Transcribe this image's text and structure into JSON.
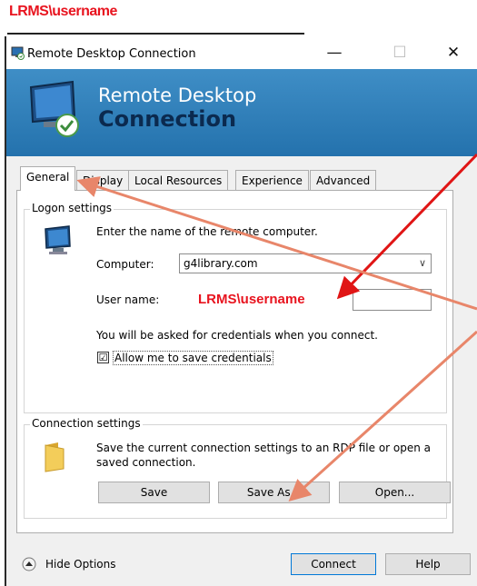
{
  "annotation": {
    "top_label": "LRMS\\username",
    "overlay_username": "LRMS\\username"
  },
  "window": {
    "title": "Remote Desktop Connection",
    "minimize_glyph": "—",
    "maximize_glyph": "☐",
    "close_glyph": "✕"
  },
  "banner": {
    "line1": "Remote Desktop",
    "line2": "Connection"
  },
  "tabs": [
    "General",
    "Display",
    "Local Resources",
    "Experience",
    "Advanced"
  ],
  "logon": {
    "group_title": "Logon settings",
    "instruction": "Enter the name of the remote computer.",
    "computer_label": "Computer:",
    "computer_value": "g4library.com",
    "username_label": "User name:",
    "username_value": "",
    "credentials_note": "You will be asked for credentials when you connect.",
    "save_credentials_label": "Allow me to save credentials",
    "save_credentials_checked": "☑"
  },
  "connection": {
    "group_title": "Connection settings",
    "description_line1": "Save the current connection settings to an RDP file or open a",
    "description_line2": "saved connection.",
    "save_button": "Save",
    "save_as_button": "Save As...",
    "open_button": "Open..."
  },
  "footer": {
    "hide_options": "Hide Options",
    "connect_button": "Connect",
    "help_button": "Help"
  },
  "colors": {
    "annotation_red": "#e8141f",
    "arrow_orange": "#e8866a",
    "banner_blue": "#2f7fbf"
  }
}
